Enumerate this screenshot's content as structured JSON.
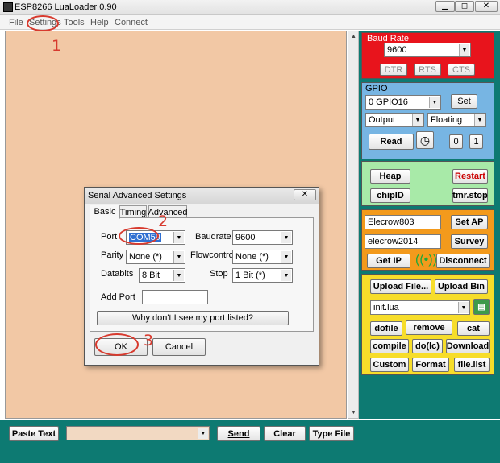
{
  "window": {
    "title": "ESP8266 LuaLoader 0.90",
    "min": "▁",
    "max": "◻",
    "close": "✕"
  },
  "menu": [
    "File",
    "Settings",
    "Tools",
    "Help",
    "Connect"
  ],
  "baud": {
    "label": "Baud Rate",
    "value": "9600",
    "dtr": "DTR",
    "rts": "RTS",
    "cts": "CTS"
  },
  "gpio": {
    "label": "GPIO",
    "pin": "0 GPIO16",
    "set": "Set",
    "mode": "Output",
    "pull": "Floating",
    "read": "Read",
    "zero": "0",
    "one": "1"
  },
  "heap": {
    "heap": "Heap",
    "restart": "Restart",
    "chipid": "chipID",
    "tmrstop": "tmr.stop"
  },
  "wifi": {
    "ssid": "Elecrow803",
    "setap": "Set AP",
    "password": "elecrow2014",
    "survey": "Survey",
    "getip": "Get IP",
    "disconnect": "Disconnect"
  },
  "files": {
    "upload_file": "Upload File...",
    "upload_bin": "Upload Bin",
    "selected": "init.lua",
    "dofile": "dofile",
    "remove": "remove",
    "cat": "cat",
    "compile": "compile",
    "dolc": "do(lc)",
    "download": "Download",
    "custom": "Custom",
    "format": "Format",
    "filelist": "file.list"
  },
  "bottom": {
    "paste": "Paste Text",
    "send": "Send",
    "clear": "Clear",
    "typefile": "Type File"
  },
  "dialog": {
    "title": "Serial Advanced Settings",
    "tabs": [
      "Basic",
      "Timing",
      "Advanced"
    ],
    "port_label": "Port",
    "port_value": "COM59",
    "baud_label": "Baudrate",
    "baud_value": "9600",
    "parity_label": "Parity",
    "parity_value": "None (*)",
    "flow_label": "Flowcontrol",
    "flow_value": "None (*)",
    "databits_label": "Databits",
    "databits_value": "8 Bit",
    "stop_label": "Stop",
    "stop_value": "1 Bit (*)",
    "addport_label": "Add Port",
    "why_button": "Why don't I see my port listed?",
    "ok": "OK",
    "cancel": "Cancel"
  },
  "annotations": {
    "one": "1",
    "two": "2",
    "three": "3"
  },
  "colors": {
    "editor_bg": "#f2c8a5",
    "baud_panel": "#e8141c",
    "gpio_panel": "#77b5e3",
    "heap_panel": "#a8eaa8",
    "wifi_panel": "#f39a1c",
    "file_panel": "#f7dd2a",
    "teal": "#0d7a72",
    "annotation": "#d73a2e"
  }
}
